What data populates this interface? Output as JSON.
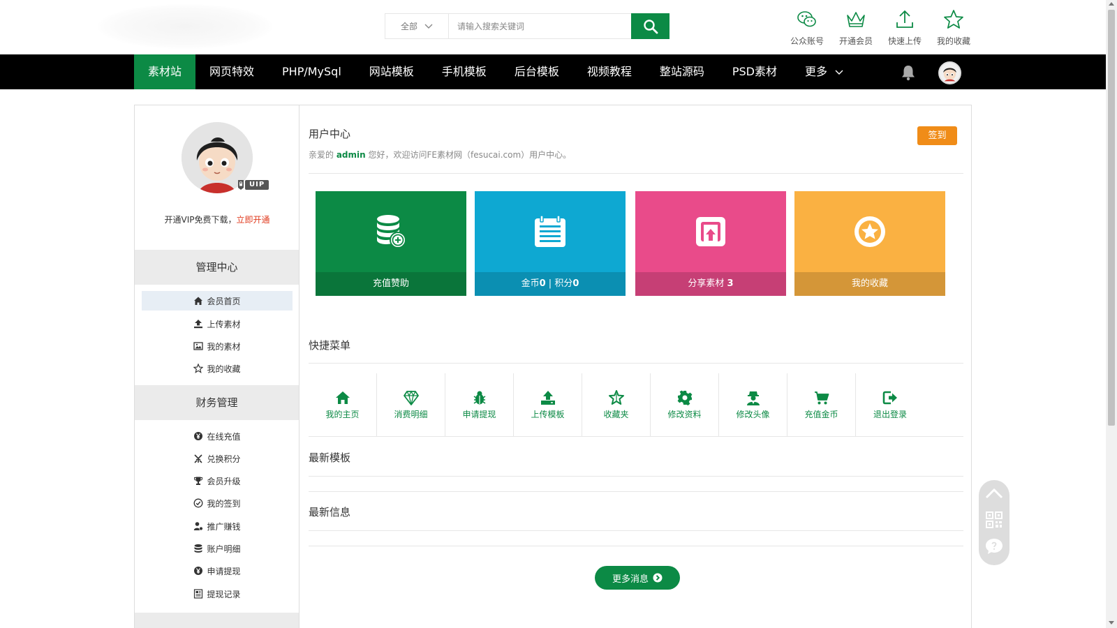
{
  "header": {
    "search_category": "全部",
    "search_placeholder": "请输入搜索关键词",
    "tools": [
      {
        "label": "公众账号",
        "icon": "wechat-icon"
      },
      {
        "label": "开通会员",
        "icon": "crown-icon"
      },
      {
        "label": "快速上传",
        "icon": "upload-icon"
      },
      {
        "label": "我的收藏",
        "icon": "star-icon"
      }
    ]
  },
  "nav": {
    "items": [
      "素材站",
      "网页特效",
      "PHP/MySql",
      "网站模板",
      "手机模板",
      "后台模板",
      "视频教程",
      "整站源码",
      "PSD素材",
      "更多"
    ],
    "active_index": 0
  },
  "sidebar": {
    "vip_badge": "UIP",
    "vip_promo": "开通VIP免费下载，",
    "vip_link": "立即开通",
    "section1": "管理中心",
    "section1_items": [
      "会员首页",
      "上传素材",
      "我的素材",
      "我的收藏"
    ],
    "section2": "财务管理",
    "section2_items": [
      "在线充值",
      "兑换积分",
      "会员升级",
      "我的签到",
      "推广赚钱",
      "账户明细",
      "申请提现",
      "提现记录"
    ]
  },
  "main": {
    "title": "用户中心",
    "welcome_prefix": "亲爱的 ",
    "username": "admin",
    "welcome_suffix": " 您好，欢迎访问FE素材网（fesucai.com）用户中心。",
    "signin": "签到",
    "cards": [
      {
        "label": "充值赞助",
        "color": "#0c8a45",
        "icon": "coins-icon"
      },
      {
        "label_prefix": "金币",
        "coin": "0",
        "label_mid": " | 积分",
        "points": "0",
        "color": "#0ea8d2",
        "icon": "calendar-list-icon"
      },
      {
        "label_prefix": "分享素材 ",
        "share_count": "3",
        "color": "#e94b8a",
        "icon": "share-upload-icon"
      },
      {
        "label": "我的收藏",
        "color": "#fab142",
        "icon": "star-circle-icon"
      }
    ],
    "quick_menu_title": "快捷菜单",
    "quick_menu": [
      "我的主页",
      "消费明细",
      "申请提现",
      "上传模板",
      "收藏夹",
      "修改资料",
      "修改头像",
      "充值金币",
      "退出登录"
    ],
    "latest_templates_title": "最新模板",
    "latest_info_title": "最新信息",
    "more_button": "更多消息"
  },
  "colors": {
    "brand": "#0c8a45",
    "accent": "#f08c18",
    "promo_link": "#e03a1e"
  }
}
